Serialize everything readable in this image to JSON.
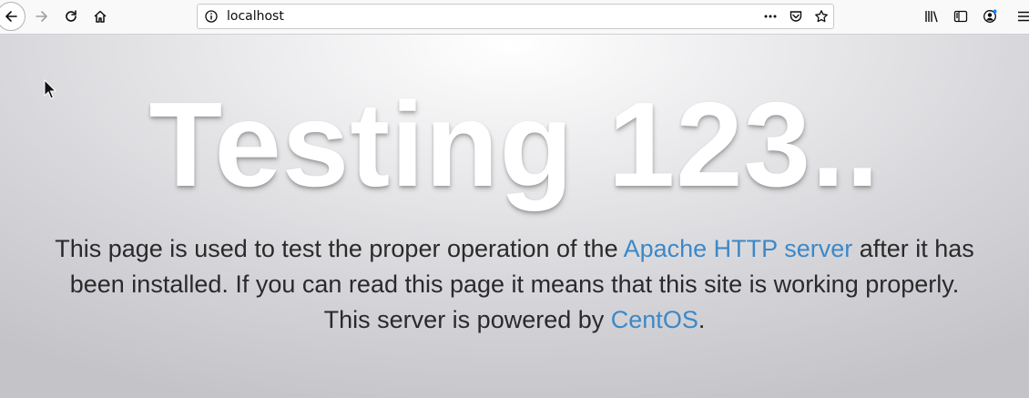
{
  "browser": {
    "url": "localhost",
    "icons": {
      "back": "back-arrow-icon",
      "forward": "forward-arrow-icon",
      "reload": "reload-icon",
      "home": "home-icon",
      "site_info": "info-icon",
      "page_actions": "more-horizontal-icon",
      "pocket": "pocket-icon",
      "bookmark": "star-icon",
      "library": "library-icon",
      "sidebar": "sidebar-icon",
      "account": "account-icon",
      "menu": "hamburger-menu-icon"
    }
  },
  "page": {
    "headline": "Testing 123..",
    "description_part1": "This page is used to test the proper operation of the ",
    "apache_link": "Apache HTTP server",
    "description_part2": " after it has been installed. If you can read this page it means that this site is working properly. This server is powered by ",
    "centos_link": "CentOS",
    "description_end": ".",
    "colors": {
      "link": "#3c88c8",
      "text": "#2a2a2a",
      "headline": "#ffffff"
    }
  }
}
